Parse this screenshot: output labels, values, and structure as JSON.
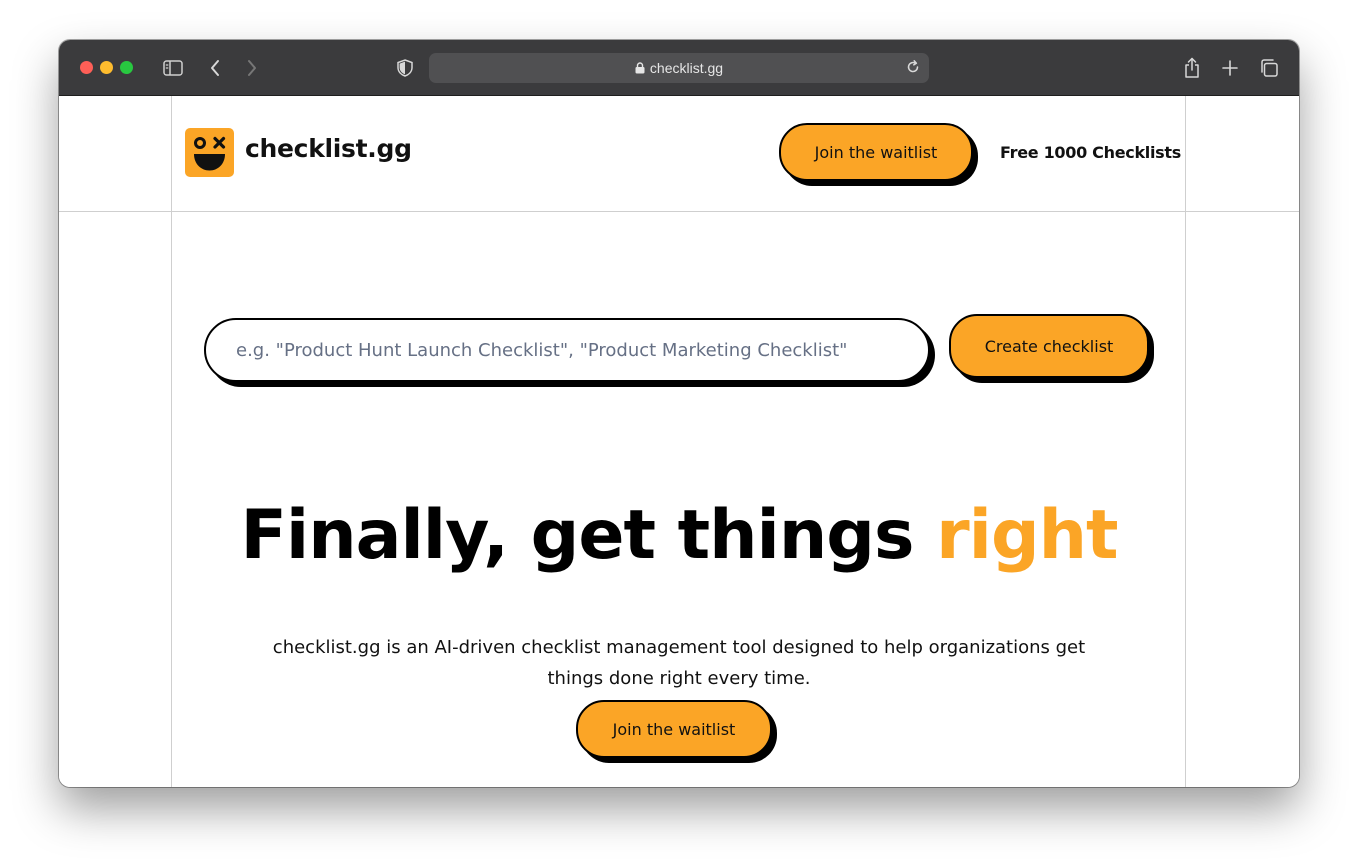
{
  "browser": {
    "url": "checklist.gg",
    "colors": {
      "toolbar": "#3b3b3d",
      "address_bar": "#505052"
    },
    "icons": [
      "sidebar-icon",
      "back-icon",
      "forward-icon",
      "shield-icon",
      "lock-icon",
      "reload-icon",
      "share-icon",
      "new-tab-icon",
      "tabs-overview-icon"
    ]
  },
  "header": {
    "brand": "checklist.gg",
    "logo_icon": "smiley-logo-icon",
    "waitlist_label": "Join the waitlist",
    "free_link": "Free 1000 Checklists"
  },
  "hero": {
    "search_placeholder": "e.g. \"Product Hunt Launch Checklist\", \"Product Marketing Checklist\"",
    "create_label": "Create checklist",
    "headline_main": "Finally, get things ",
    "headline_accent": "right",
    "description": "checklist.gg is an AI-driven checklist management tool designed to help organizations get things done right every time.",
    "cta_label": "Join the waitlist"
  },
  "colors": {
    "accent": "#fba526",
    "text": "#111111",
    "grid_line": "#cfcfcf"
  }
}
